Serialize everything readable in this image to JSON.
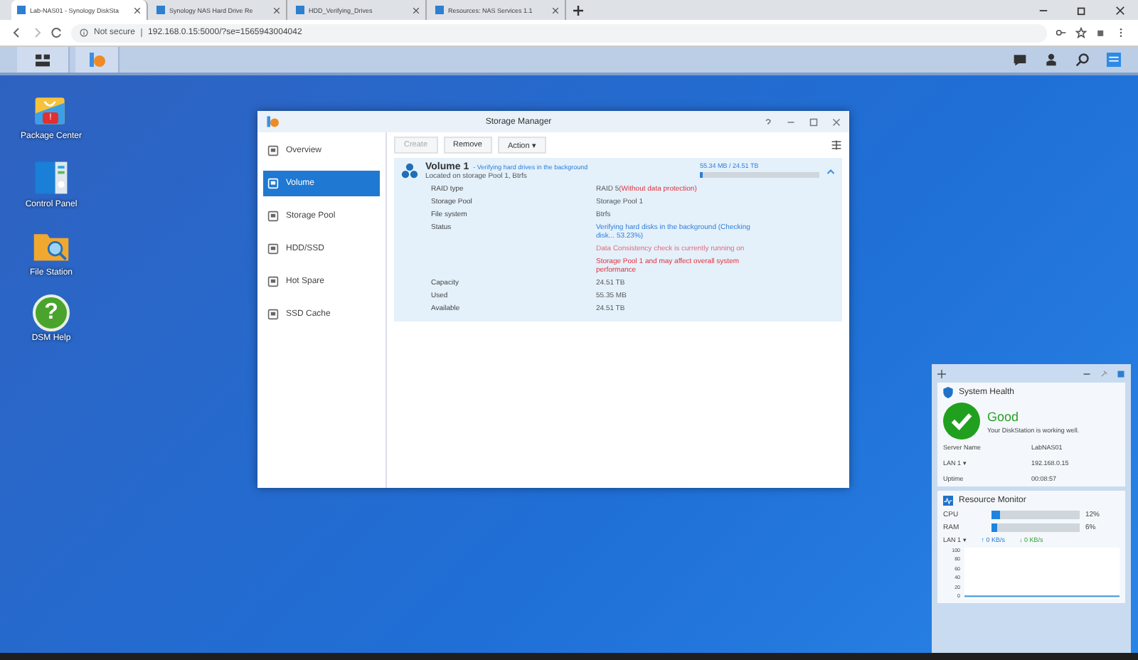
{
  "browser": {
    "tabs": [
      {
        "title": "Lab-NAS01 - Synology DiskSta",
        "selected": true
      },
      {
        "title": "Synology NAS Hard Drive Re",
        "selected": false
      },
      {
        "title": "HDD_Verifying_Drives",
        "selected": false
      },
      {
        "title": "Resources: NAS Services 1.1",
        "selected": false
      }
    ],
    "security": "Not secure",
    "url": "192.168.0.15:5000/?se=1565943004042"
  },
  "desktop_icons": [
    {
      "label": "Package Center",
      "kind": "package",
      "badge": "!"
    },
    {
      "label": "Control Panel",
      "kind": "control"
    },
    {
      "label": "File Station",
      "kind": "folder"
    },
    {
      "label": "DSM Help",
      "kind": "help",
      "glyph": "?"
    }
  ],
  "window": {
    "title": "Storage Manager",
    "sidebar": [
      {
        "label": "Overview",
        "selected": false
      },
      {
        "label": "Volume",
        "selected": true
      },
      {
        "label": "Storage Pool",
        "selected": false
      },
      {
        "label": "HDD/SSD",
        "selected": false
      },
      {
        "label": "Hot Spare",
        "selected": false
      },
      {
        "label": "SSD Cache",
        "selected": false
      }
    ],
    "toolbar": [
      {
        "label": "Create",
        "disabled": true
      },
      {
        "label": "Remove",
        "disabled": false
      },
      {
        "label": "Action ▾",
        "disabled": false
      }
    ],
    "volume": {
      "name": "Volume 1",
      "note": "- Verifying hard drives in the background",
      "location": "Located on storage Pool 1, Btrfs",
      "usage": "55.34 MB / 24.51 TB",
      "level": 0.02,
      "rows": [
        {
          "label": "RAID type",
          "value": "RAID 5",
          "alert": "(Without data protection)",
          "kind": "plain"
        },
        {
          "label": "Storage Pool",
          "value": "Storage Pool 1",
          "kind": "plain"
        },
        {
          "label": "File system",
          "value": "Btrfs",
          "kind": "plain"
        },
        {
          "label": "Status",
          "value": "Verifying hard disks in the background (Checking disk... 53.23%)",
          "kind": "info"
        },
        {
          "value": "Data Consistency check is currently running on",
          "kind": "warning"
        },
        {
          "value": "Storage Pool 1 and may affect overall system performance",
          "kind": "error"
        },
        {
          "label": "Capacity",
          "value": "24.51 TB",
          "kind": "plain"
        },
        {
          "label": "Used",
          "value": "55.35 MB",
          "kind": "plain"
        },
        {
          "label": "Available",
          "value": "24.51 TB",
          "kind": "plain"
        }
      ]
    }
  },
  "widgets": {
    "health": {
      "title": "System Health",
      "status": "Good",
      "message": "Your DiskStation is working well.",
      "rows": [
        {
          "label": "Server Name",
          "value": "LabNAS01"
        },
        {
          "label": "LAN 1 ▾",
          "value": "192.168.0.15"
        },
        {
          "label": "Uptime",
          "value": "00:08:57"
        }
      ]
    },
    "monitor": {
      "title": "Resource Monitor",
      "meters": [
        {
          "label": "CPU",
          "level": 0.1,
          "reading": "12%"
        },
        {
          "label": "RAM",
          "level": 0.06,
          "reading": "6%"
        }
      ],
      "lan": {
        "label": "LAN 1 ▾",
        "up": "↑ 0 KB/s",
        "down": "↓ 0 KB/s"
      },
      "ticks": [
        "100",
        "80",
        "60",
        "40",
        "20",
        "0"
      ]
    }
  }
}
